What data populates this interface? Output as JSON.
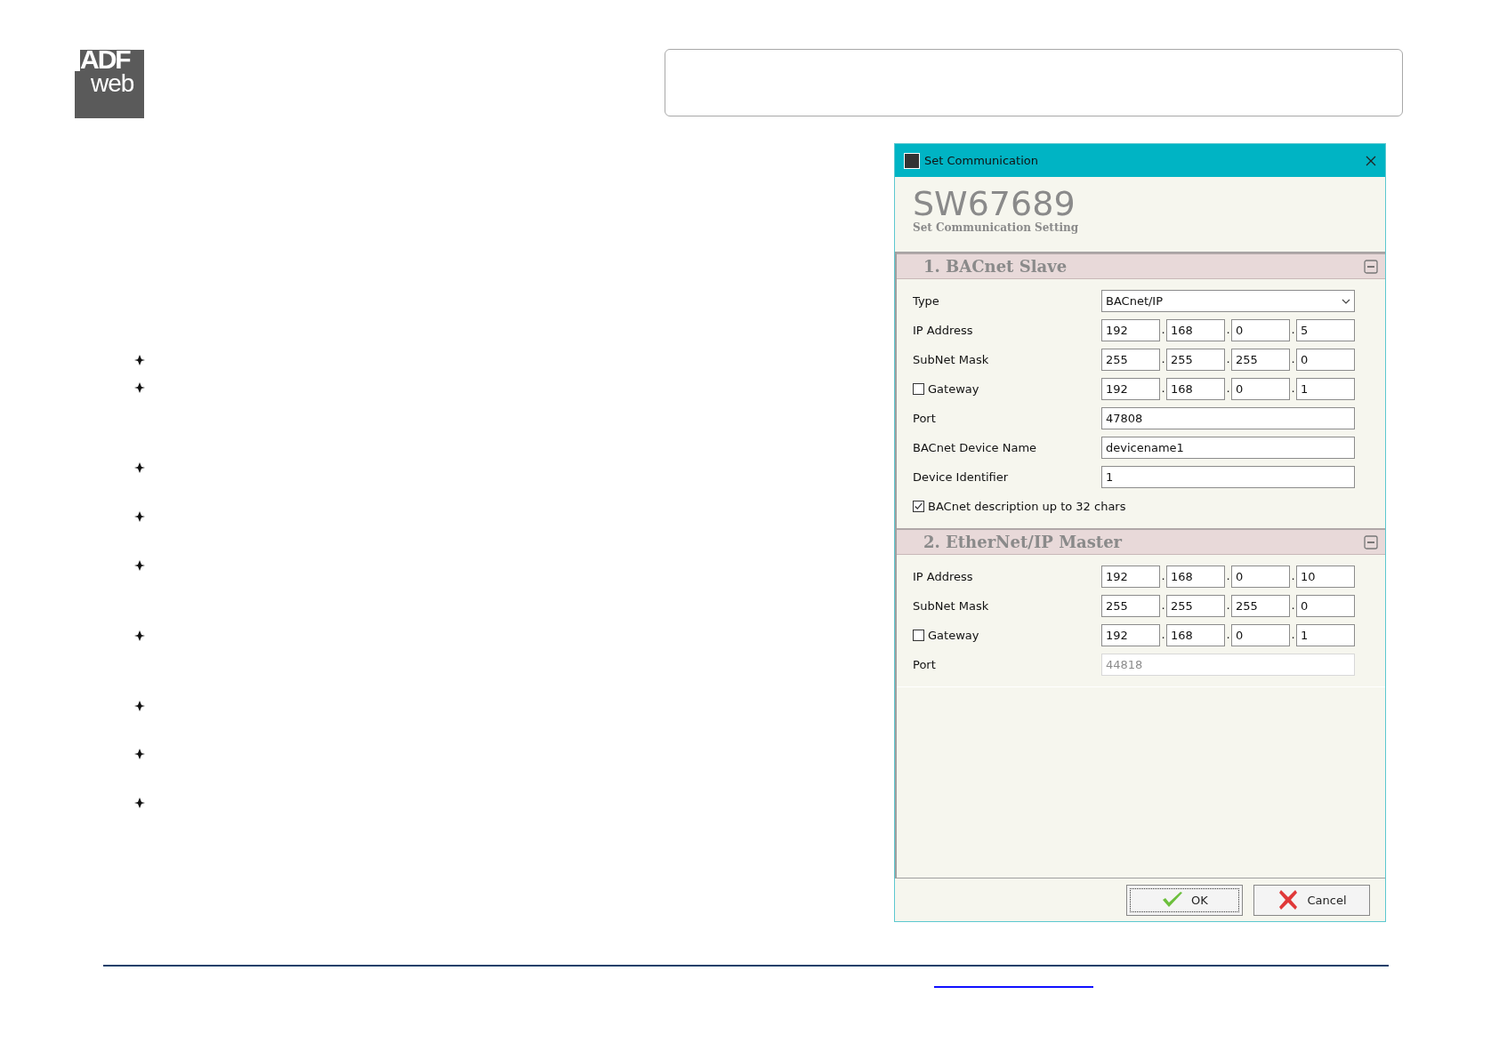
{
  "logo": {
    "top": "ADF",
    "bottom": "web"
  },
  "dialog": {
    "title": "Set Communication",
    "product": "SW67689",
    "subtitle": "Set Communication Setting",
    "sections": [
      {
        "title": "1. BACnet Slave",
        "expanded": true,
        "rows": [
          {
            "kind": "select",
            "label": "Type",
            "value": "BACnet/IP"
          },
          {
            "kind": "ip",
            "label": "IP Address",
            "octets": [
              "192",
              "168",
              "0",
              "5"
            ],
            "separators": [
              ".",
              ".",
              "."
            ]
          },
          {
            "kind": "ip",
            "label": "SubNet Mask",
            "octets": [
              "255",
              "255",
              "255",
              "0"
            ],
            "separators": [
              ".",
              ".",
              "."
            ]
          },
          {
            "kind": "ip-check",
            "label": "Gateway",
            "checked": false,
            "octets": [
              "192",
              "168",
              "0",
              "1"
            ],
            "separators": [
              ".",
              ".",
              "."
            ]
          },
          {
            "kind": "text",
            "label": "Port",
            "value": "47808",
            "disabled": false
          },
          {
            "kind": "text",
            "label": "BACnet Device Name",
            "value": "devicename1",
            "disabled": false
          },
          {
            "kind": "text",
            "label": "Device Identifier",
            "value": "1",
            "disabled": false
          },
          {
            "kind": "check",
            "label": "BACnet description up to 32 chars",
            "checked": true
          }
        ]
      },
      {
        "title": "2. EtherNet/IP Master",
        "expanded": true,
        "rows": [
          {
            "kind": "ip",
            "label": "IP Address",
            "octets": [
              "192",
              "168",
              "0",
              "10"
            ],
            "separators": [
              ".",
              ".",
              "."
            ]
          },
          {
            "kind": "ip",
            "label": "SubNet Mask",
            "octets": [
              "255",
              "255",
              "255",
              "0"
            ],
            "separators": [
              ".",
              ".",
              "."
            ]
          },
          {
            "kind": "ip-check",
            "label": "Gateway",
            "checked": false,
            "octets": [
              "192",
              "168",
              "0",
              "1"
            ],
            "separators": [
              ".",
              ".",
              "."
            ]
          },
          {
            "kind": "text",
            "label": "Port",
            "value": "44818",
            "disabled": true
          }
        ]
      }
    ],
    "buttons": [
      {
        "kind": "ok",
        "label": "OK"
      },
      {
        "kind": "cancel",
        "label": "Cancel"
      }
    ]
  }
}
